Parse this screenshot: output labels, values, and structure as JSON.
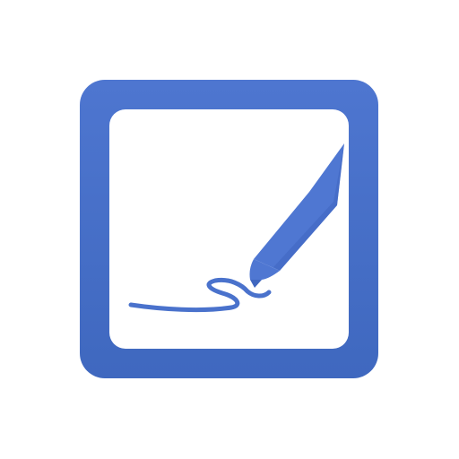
{
  "icon": {
    "name": "signature-pen-app-icon",
    "colors": {
      "background": "#ffffff",
      "frame_top": "#4e76d0",
      "frame_bottom": "#3f68bf",
      "inner_panel": "#ffffff",
      "pen": "#4f77d2",
      "pen_shadow": "#3f66bf",
      "ink": "#4a72cc"
    },
    "glyphs": [
      "frame-icon",
      "pen-icon",
      "signature-scribble-icon"
    ]
  }
}
